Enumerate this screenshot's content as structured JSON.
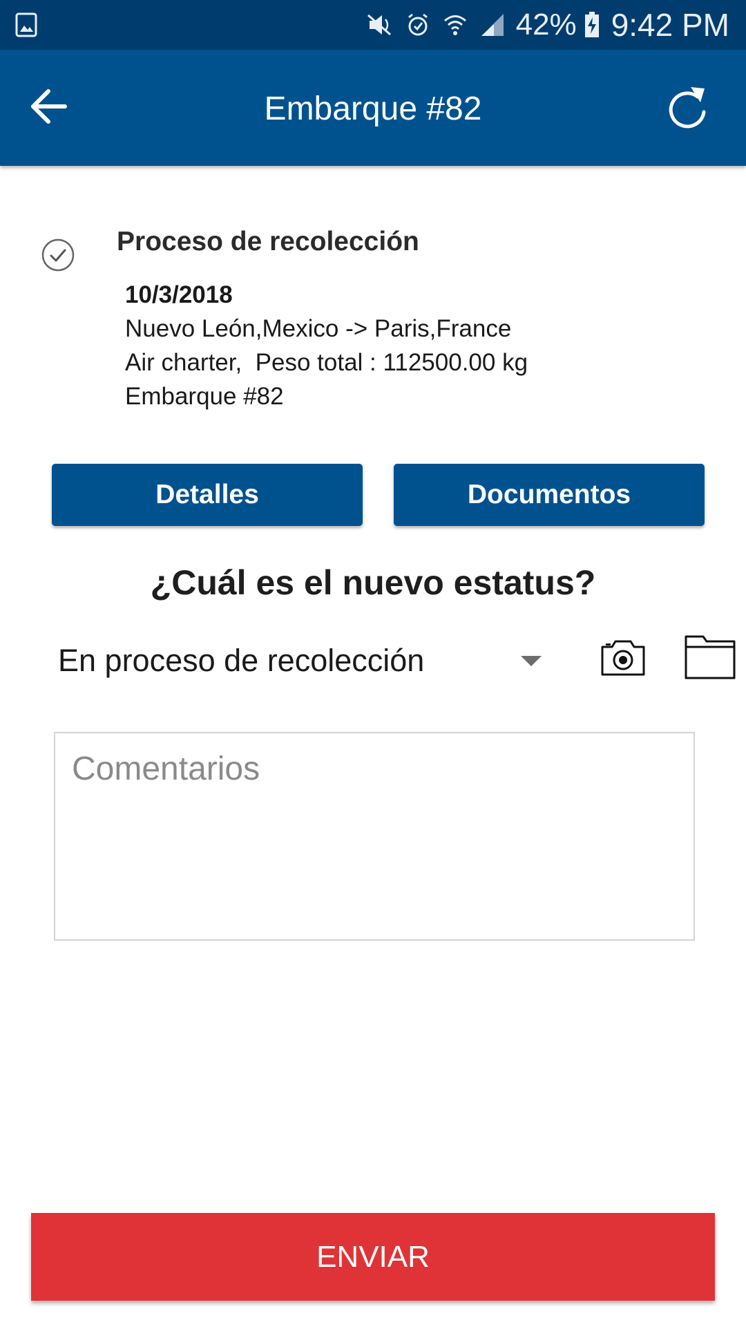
{
  "status_bar": {
    "battery_percent": "42%",
    "time": "9:42 PM",
    "icons": [
      "gallery-icon",
      "mute-icon",
      "alarm-icon",
      "wifi-icon",
      "signal-icon",
      "battery-charging-icon"
    ]
  },
  "app_bar": {
    "title": "Embarque #82",
    "back_icon": "arrow-left-icon",
    "refresh_icon": "refresh-icon",
    "color": "#00528f"
  },
  "process": {
    "title": "Proceso de recolección",
    "date": "10/3/2018",
    "route": "Nuevo León,Mexico -> Paris,France",
    "details": "Air charter,  Peso total : 112500.00 kg",
    "shipment": "Embarque #82",
    "status_icon": "check-circle-icon"
  },
  "buttons": {
    "detalles": "Detalles",
    "documentos": "Documentos"
  },
  "status_form": {
    "question": "¿Cuál es el nuevo estatus?",
    "selected_status": "En proceso de recolección",
    "camera_icon": "camera-icon",
    "folder_icon": "folder-icon"
  },
  "comments": {
    "placeholder": "Comentarios",
    "value": ""
  },
  "send": {
    "label": "ENVIAR",
    "color": "#e03337"
  }
}
